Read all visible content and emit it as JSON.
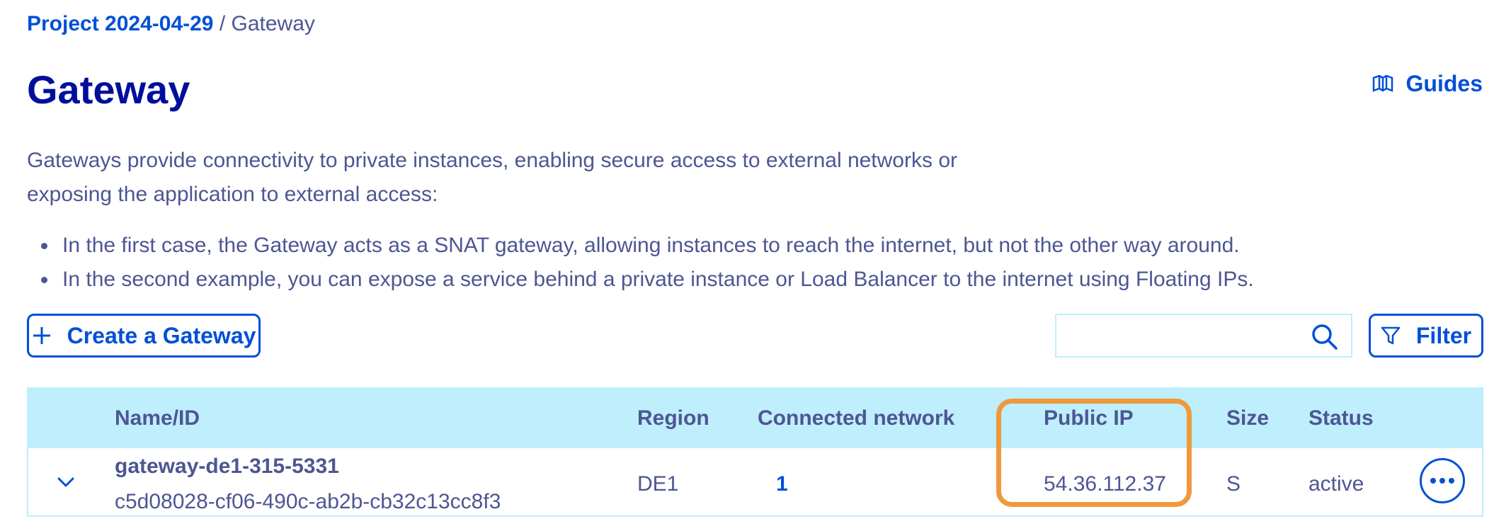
{
  "breadcrumb": {
    "project": "Project 2024-04-29",
    "separator": " / ",
    "current": "Gateway"
  },
  "page": {
    "title": "Gateway",
    "guides_label": "Guides"
  },
  "intro": {
    "paragraph": "Gateways provide connectivity to private instances, enabling secure access to external networks or exposing the application to external access:",
    "bullets": [
      "In the first case, the Gateway acts as a SNAT gateway, allowing instances to reach the internet, but not the other way around.",
      "In the second example, you can expose a service behind a private instance or Load Balancer to the internet using Floating IPs."
    ]
  },
  "toolbar": {
    "create_label": "Create a Gateway",
    "search_placeholder": "",
    "filter_label": "Filter"
  },
  "table": {
    "headers": {
      "name": "Name/ID",
      "region": "Region",
      "network": "Connected network",
      "public_ip": "Public IP",
      "size": "Size",
      "status": "Status"
    },
    "rows": [
      {
        "name": "gateway-de1-315-5331",
        "id": "c5d08028-cf06-490c-ab2b-cb32c13cc8f3",
        "region": "DE1",
        "network": "1",
        "public_ip": "54.36.112.37",
        "size": "S",
        "status": "active"
      }
    ]
  },
  "colors": {
    "accent": "#0050d7",
    "title": "#000e9c",
    "text": "#4d5693",
    "header_bg": "#bfeefc",
    "highlight": "#f0993b"
  },
  "icons": {
    "guides": "book-icon",
    "create": "plus-icon",
    "search": "search-icon",
    "filter": "filter-icon",
    "expand": "chevron-down-icon",
    "actions": "more-horizontal-icon"
  }
}
